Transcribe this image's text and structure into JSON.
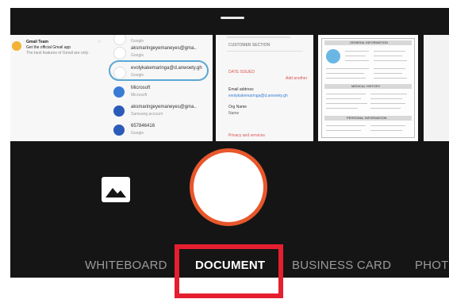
{
  "colors": {
    "background": "#151515",
    "shutter_ring": "#e8572c",
    "highlight_box": "#e51f2f",
    "active_mode": "#ffffff",
    "inactive_mode": "#9a9a9a"
  },
  "thumbnails": {
    "mail": {
      "sender": "Gmail Team",
      "subject": "Get the official Gmail app",
      "snippet": "The best features of Gmail are only available..."
    },
    "contacts": {
      "items": [
        {
          "icon": "google-g-icon",
          "address": "",
          "sub": "Google"
        },
        {
          "icon": "google-g-icon",
          "address": "aksmaringeyemaneyes@gma..",
          "sub": "Google"
        },
        {
          "icon": "google-g-icon",
          "address": "evolykakemaringa@d.anwoety.gh",
          "sub": "Google"
        },
        {
          "icon": "microsoft-icon",
          "address": "Microsoft",
          "sub": "Microsoft"
        },
        {
          "icon": "person-icon",
          "address": "aksmaringeyemaneyes@gma..",
          "sub": "Samsung account"
        },
        {
          "icon": "phone-icon",
          "address": "657846416",
          "sub": "Google"
        }
      ]
    },
    "form": {
      "header_label": "CUSTOMER SECTION",
      "field_label": "DATE ISSUED",
      "link_label": "Add another",
      "email_label": "Email address",
      "email_value": "evolykakemaringa@d.anwoety.gh",
      "org_label": "Org Name",
      "org_value": "Name",
      "footer_label": "Privacy and services"
    },
    "document": {
      "title": "GENERAL INFORMATION",
      "section2": "MEDICAL HISTORY",
      "section3": "PERSONAL INFORMATION"
    }
  },
  "controls": {
    "gallery_icon": "image-icon",
    "shutter_icon": "shutter-button"
  },
  "modes": [
    {
      "label": "WHITEBOARD",
      "active": false
    },
    {
      "label": "DOCUMENT",
      "active": true
    },
    {
      "label": "BUSINESS CARD",
      "active": false
    },
    {
      "label": "PHOTO",
      "active": false
    }
  ]
}
